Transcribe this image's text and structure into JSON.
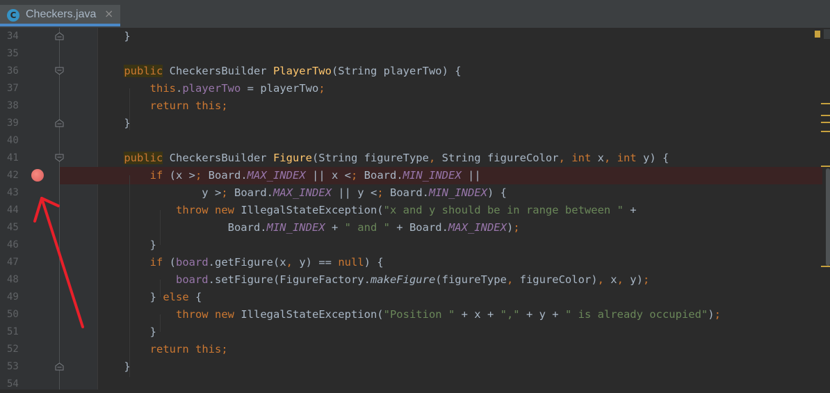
{
  "tab": {
    "icon_letter": "C",
    "label": "Checkers.java",
    "close": "×"
  },
  "lines": [
    {
      "num": "34",
      "code": "    }"
    },
    {
      "num": "35",
      "code": ""
    },
    {
      "num": "36",
      "code": "    public CheckersBuilder PlayerTwo(String playerTwo) {"
    },
    {
      "num": "37",
      "code": "        this.playerTwo = playerTwo;"
    },
    {
      "num": "38",
      "code": "        return this;"
    },
    {
      "num": "39",
      "code": "    }"
    },
    {
      "num": "40",
      "code": ""
    },
    {
      "num": "41",
      "code": "    public CheckersBuilder Figure(String figureType, String figureColor, int x, int y) {"
    },
    {
      "num": "42",
      "code": "        if (x > Board.MAX_INDEX || x < Board.MIN_INDEX ||"
    },
    {
      "num": "43",
      "code": "                y > Board.MAX_INDEX || y < Board.MIN_INDEX) {"
    },
    {
      "num": "44",
      "code": "            throw new IllegalStateException(\"x and y should be in range between \" +"
    },
    {
      "num": "45",
      "code": "                    Board.MIN_INDEX + \" and \" + Board.MAX_INDEX);"
    },
    {
      "num": "46",
      "code": "        }"
    },
    {
      "num": "47",
      "code": "        if (board.getFigure(x, y) == null) {"
    },
    {
      "num": "48",
      "code": "            board.setFigure(FigureFactory.makeFigure(figureType, figureColor), x, y);"
    },
    {
      "num": "49",
      "code": "        } else {"
    },
    {
      "num": "50",
      "code": "            throw new IllegalStateException(\"Position \" + x + \",\" + y + \" is already occupied\");"
    },
    {
      "num": "51",
      "code": "        }"
    },
    {
      "num": "52",
      "code": "        return this;"
    },
    {
      "num": "53",
      "code": "    }"
    },
    {
      "num": "54",
      "code": ""
    }
  ],
  "icons": {
    "breakpoint": "breakpoint-icon",
    "fold": "fold-icon",
    "arrow": "red-arrow-annotation"
  },
  "colors": {
    "background": "#2b2b2b",
    "keyword": "#cc7832",
    "method": "#ffc66d",
    "field": "#9876aa",
    "string": "#6a8759",
    "breakpoint": "#db5c5c",
    "annotation_arrow": "#e8202a"
  }
}
